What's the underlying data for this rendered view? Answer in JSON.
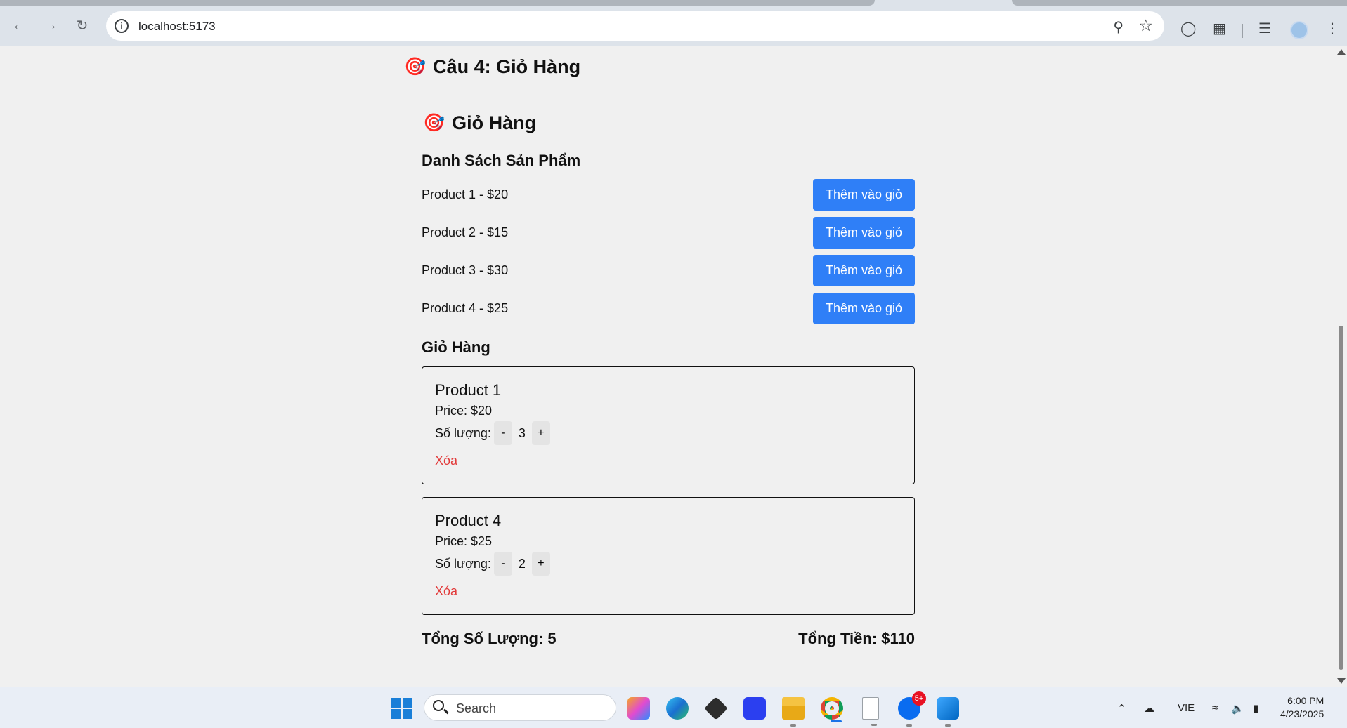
{
  "browser": {
    "url": "localhost:5173"
  },
  "page": {
    "title": "Câu 4: Giỏ Hàng",
    "cart_heading": "Giỏ Hàng",
    "product_list_heading": "Danh Sách Sản Phẩm",
    "add_button_label": "Thêm vào giỏ",
    "products": [
      {
        "label": "Product 1 - $20"
      },
      {
        "label": "Product 2 - $15"
      },
      {
        "label": "Product 3 - $30"
      },
      {
        "label": "Product 4 - $25"
      }
    ],
    "cart_section_heading": "Giỏ Hàng",
    "cart_items": [
      {
        "name": "Product 1",
        "price": "Price: $20",
        "qty_label": "Số lượng:",
        "minus": "-",
        "qty": "3",
        "plus": "+",
        "remove": "Xóa"
      },
      {
        "name": "Product 4",
        "price": "Price: $25",
        "qty_label": "Số lượng:",
        "minus": "-",
        "qty": "2",
        "plus": "+",
        "remove": "Xóa"
      }
    ],
    "total_quantity": "Tổng Số Lượng: 5",
    "total_price": "Tổng Tiền: $110"
  },
  "taskbar": {
    "search_placeholder": "Search",
    "zalo_badge": "5+",
    "language": "VIE",
    "time": "6:00 PM",
    "date": "4/23/2025"
  },
  "colors": {
    "accent_button": "#2f7ff7",
    "remove_link": "#e23a3a"
  }
}
